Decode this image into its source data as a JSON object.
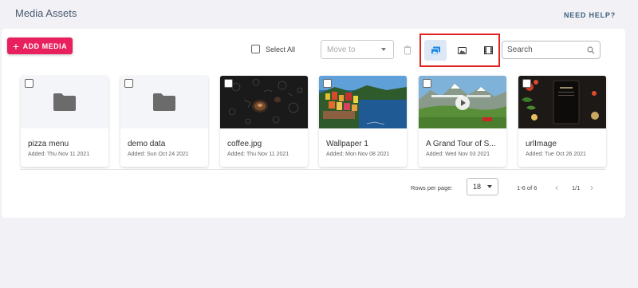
{
  "header": {
    "title": "Media Assets",
    "help_link": "NEED HELP?"
  },
  "toolbar": {
    "add_icon": "plus-icon",
    "add_label": "ADD MEDIA",
    "select_all_label": "Select All",
    "move_to_placeholder": "Move to",
    "delete_icon": "trash-icon",
    "view_modes": [
      "all-media-view-icon",
      "images-view-icon",
      "videos-view-icon"
    ],
    "active_view": "all-media-view-icon",
    "search_placeholder": "Search",
    "search_icon": "search-icon"
  },
  "media": [
    {
      "name": "pizza menu",
      "added": "Added: Thu Nov 11 2021",
      "kind": "folder"
    },
    {
      "name": "demo data",
      "added": "Added: Sun Oct 24 2021",
      "kind": "folder"
    },
    {
      "name": "coffee.jpg",
      "added": "Added: Thu Nov 11 2021",
      "kind": "image"
    },
    {
      "name": "Wallpaper 1",
      "added": "Added: Mon Nov 08 2021",
      "kind": "image"
    },
    {
      "name": "A Grand Tour of S...",
      "added": "Added: Wed Nov 03 2021",
      "kind": "video"
    },
    {
      "name": "urlImage",
      "added": "Added: Tue Oct 26 2021",
      "kind": "image"
    }
  ],
  "pagination": {
    "rows_per_page_label": "Rows per page:",
    "rows_per_page_value": "18",
    "range_text": "1-6 of 6",
    "page_indicator": "1/1"
  },
  "colors": {
    "accent": "#e8205d",
    "highlight_box": "#e0231f",
    "active_view_bg": "#dde8f7",
    "view_icon_active": "#1e88e5"
  }
}
